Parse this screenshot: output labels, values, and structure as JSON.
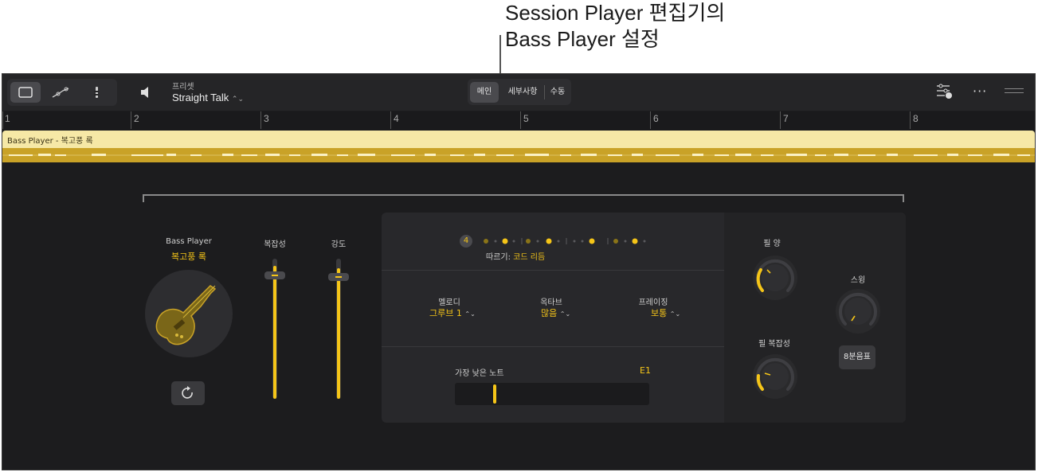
{
  "callout": {
    "line1": "Session Player 편집기의",
    "line2": "Bass Player 설정"
  },
  "toolbar": {
    "view_buttons": [
      "single-view",
      "automation-view",
      "notation-view"
    ],
    "preset_label": "프리셋",
    "preset_value": "Straight Talk",
    "tabs": [
      {
        "label": "메인",
        "selected": true
      },
      {
        "label": "세부사항",
        "selected": false
      },
      {
        "label": "수동",
        "selected": false
      }
    ]
  },
  "ruler": {
    "bars": [
      "1",
      "2",
      "3",
      "4",
      "5",
      "6",
      "7",
      "8"
    ]
  },
  "region": {
    "label": "Bass Player - 복고풍 록"
  },
  "player": {
    "name": "Bass Player",
    "style": "복고풍 록"
  },
  "sliders": {
    "complexity_label": "복잡성",
    "complexity_value": 0.95,
    "intensity_label": "강도",
    "intensity_value": 0.93
  },
  "follow": {
    "badge": "4",
    "label": "따르기:",
    "value": "코드 리듬"
  },
  "options": {
    "melody_label": "멜로디",
    "melody_value": "그루브 1",
    "octave_label": "옥타브",
    "octave_value": "많음",
    "phrasing_label": "프레이징",
    "phrasing_value": "보통"
  },
  "lowest_note": {
    "label": "가장 낮은 노트",
    "value": "E1"
  },
  "fills": {
    "amount_label": "필 양",
    "complexity_label": "필 복잡성"
  },
  "swing": {
    "label": "스윙",
    "note_value": "8분음표"
  },
  "colors": {
    "accent": "#f5c518",
    "region_top": "#f6e8a6",
    "region_bottom": "#c9a227",
    "background": "#1c1c1e"
  }
}
